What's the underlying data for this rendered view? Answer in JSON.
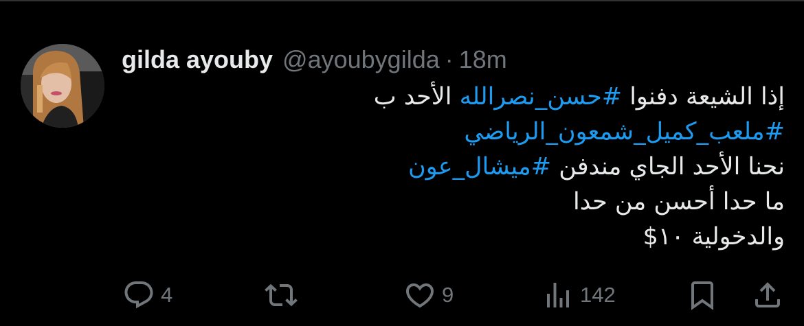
{
  "tweet": {
    "author": {
      "display_name": "gilda ayouby",
      "handle": "@ayoubygilda"
    },
    "separator": "·",
    "time": "18m",
    "lines": [
      [
        {
          "text": "إذا الشيعة دفنوا ",
          "hashtag": false
        },
        {
          "text": "#حسن_نصرالله",
          "hashtag": true
        },
        {
          "text": " الأحد ب",
          "hashtag": false
        }
      ],
      [
        {
          "text": "#ملعب_كميل_شمعون_الرياضي",
          "hashtag": true
        }
      ],
      [
        {
          "text": "نحنا الأحد الجاي مندفن ",
          "hashtag": false
        },
        {
          "text": "#ميشال_عون",
          "hashtag": true
        }
      ],
      [
        {
          "text": "ما حدا أحسن من حدا",
          "hashtag": false
        }
      ],
      [
        {
          "text": "والدخولية ١٠$",
          "hashtag": false
        }
      ]
    ]
  },
  "actions": {
    "reply": {
      "icon": "reply-icon",
      "count": "4"
    },
    "retweet": {
      "icon": "retweet-icon",
      "count": ""
    },
    "like": {
      "icon": "heart-icon",
      "count": "9"
    },
    "views": {
      "icon": "views-icon",
      "count": "142"
    },
    "bookmark": {
      "icon": "bookmark-icon",
      "count": ""
    },
    "share": {
      "icon": "share-icon",
      "count": ""
    }
  },
  "colors": {
    "background": "#000000",
    "text": "#e7e9ea",
    "muted": "#71767b",
    "link": "#1d9bf0",
    "divider": "#2f3336"
  }
}
